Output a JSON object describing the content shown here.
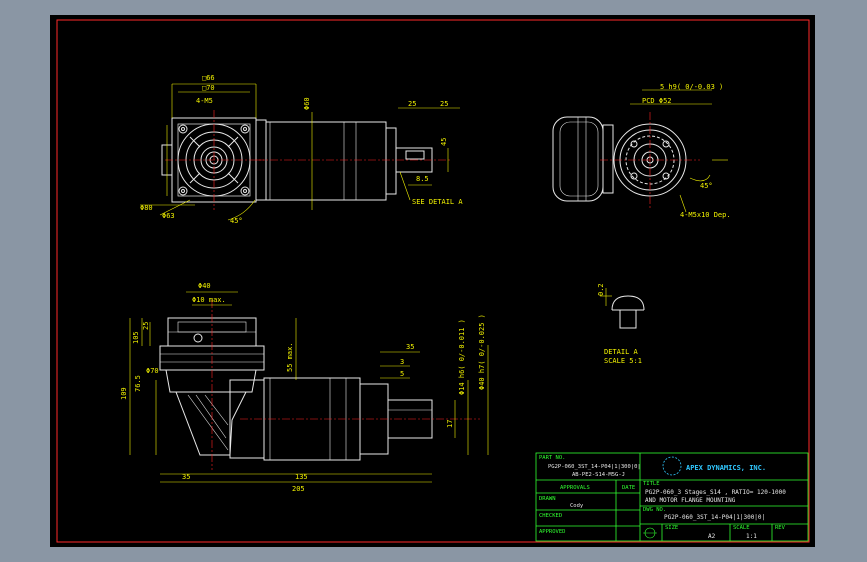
{
  "drawing": {
    "dimensions": {
      "box_top": "□66",
      "box_left": "□70",
      "thread_top": "4-M5",
      "dia60": "Φ60",
      "dim25a": "25",
      "dim25b": "25",
      "dim45": "45",
      "dim85": "8.5",
      "dia80": "Φ80",
      "dia63": "Φ63",
      "angle45": "45°",
      "see_detail": "SEE DETAIL A",
      "key": "5 h9( 0/-0.03 )",
      "pcd": "PCD Φ52",
      "angle45b": "45°",
      "thread_right": "4-M5x10 Dep.",
      "dia40": "Φ40",
      "dia10": "Φ10 max.",
      "dim105": "105",
      "dim25c": "25",
      "dia70": "Φ70",
      "dim765": "76.5",
      "dim109": "109",
      "dim55": "55 max.",
      "dim35": "35",
      "dim3": "3",
      "dim5": "5",
      "dia14": "Φ14 h6( 0/-0.011 )",
      "dia40b": "Φ40 h7( 0/-0.025 )",
      "dim17": "17",
      "dim135": "135",
      "dim35b": "35",
      "dim205": "205",
      "dim02": "0.2",
      "detail_a": "DETAIL A",
      "detail_scale": "SCALE 5:1"
    }
  },
  "title_block": {
    "part_no_label": "PART NO.",
    "part_no_line1": "PG2P-060_3ST_14-P04|1|300|0|",
    "part_no_line2": "AB-PE2-S14-M5G-J",
    "approval_label": "APPROVALS",
    "date_label": "DATE",
    "drawn_label": "DRAWN",
    "drawn_value": "Cody",
    "checked_label": "CHECKED",
    "approved_label": "APPROVED",
    "company": "APEX DYNAMICS, INC.",
    "title_label": "TITLE",
    "title_line1": "PG2P-060_3 Stages_S14 , RATIO= 120-1000",
    "title_line2": "AND MOTOR FLANGE MOUNTING",
    "dwg_no_label": "DWG NO.",
    "dwg_no_value": "PG2P-060_3ST_14-P04|1|300|0|",
    "size_label": "SIZE",
    "size_value": "A2",
    "scale_label": "SCALE",
    "scale_value": "1:1",
    "rev_label": "REV"
  }
}
